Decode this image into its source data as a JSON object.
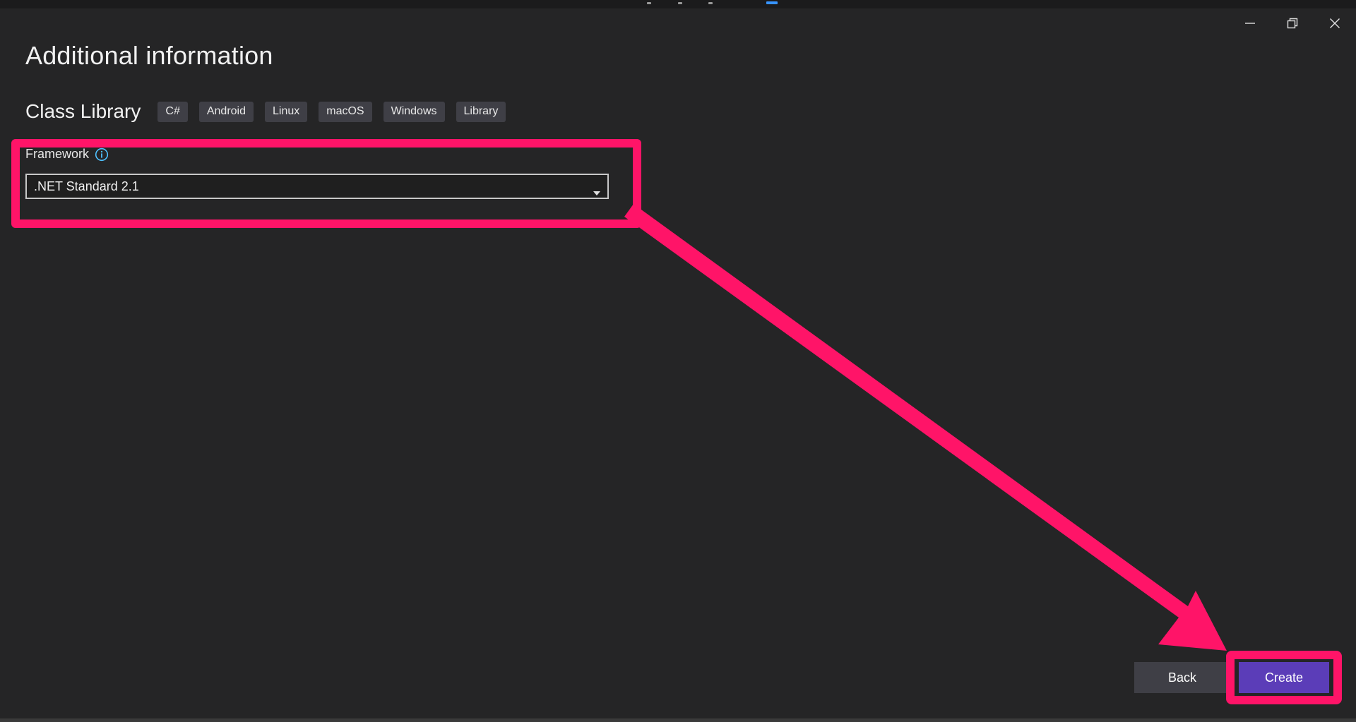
{
  "window": {
    "title": "Additional information",
    "controls": {
      "minimize_icon": "minimize-icon",
      "restore_icon": "restore-icon",
      "close_icon": "close-icon"
    }
  },
  "template": {
    "name": "Class Library",
    "tags": [
      "C#",
      "Android",
      "Linux",
      "macOS",
      "Windows",
      "Library"
    ]
  },
  "framework": {
    "label": "Framework",
    "info_icon": "info-icon",
    "selected": ".NET Standard 2.1"
  },
  "footer": {
    "back_label": "Back",
    "create_label": "Create"
  },
  "annotation": {
    "highlight_color": "#ff1468",
    "accent_color": "#5b3db8"
  }
}
